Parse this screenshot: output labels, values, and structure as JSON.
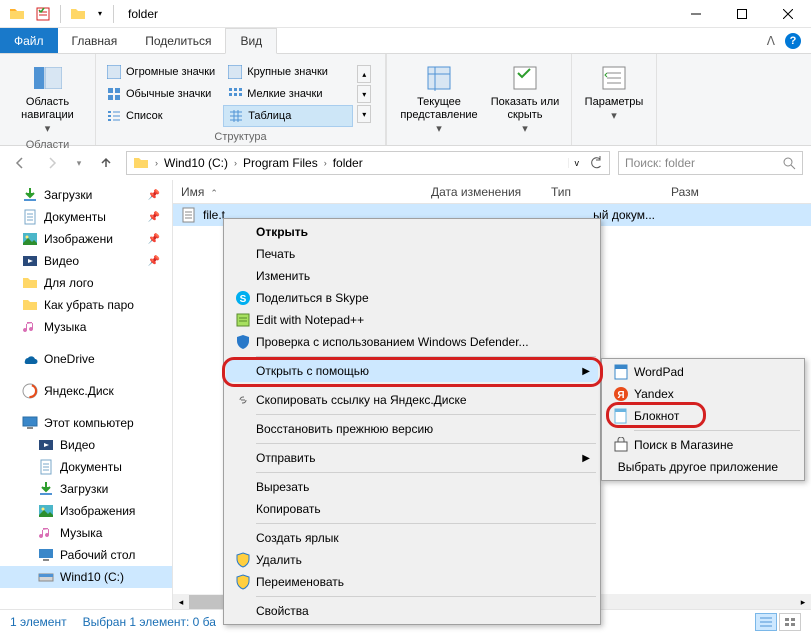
{
  "window": {
    "title": "folder",
    "controls": {
      "min": "—",
      "max": "□",
      "close": "✕"
    }
  },
  "tabs": {
    "file": "Файл",
    "home": "Главная",
    "share": "Поделиться",
    "view": "Вид"
  },
  "ribbon": {
    "nav_pane_label": "Область навигации",
    "layouts": {
      "huge": "Огромные значки",
      "large": "Крупные значки",
      "medium": "Обычные значки",
      "small": "Мелкие значки",
      "list": "Список",
      "table": "Таблица"
    },
    "group_areas": "Области",
    "group_structure": "Структура",
    "current_view": "Текущее представление",
    "show_hide": "Показать или скрыть",
    "options": "Параметры"
  },
  "breadcrumb": {
    "drive": "Wind10 (C:)",
    "folder1": "Program Files",
    "folder2": "folder"
  },
  "search": {
    "placeholder": "Поиск: folder"
  },
  "sidebar": {
    "items": [
      {
        "label": "Загрузки",
        "pinned": true,
        "icon": "download"
      },
      {
        "label": "Документы",
        "pinned": true,
        "icon": "doc"
      },
      {
        "label": "Изображени",
        "pinned": true,
        "icon": "picture"
      },
      {
        "label": "Видео",
        "pinned": true,
        "icon": "video"
      },
      {
        "label": "Для лого",
        "pinned": false,
        "icon": "folder"
      },
      {
        "label": "Как убрать паро",
        "pinned": false,
        "icon": "folder"
      },
      {
        "label": "Музыка",
        "pinned": false,
        "icon": "music"
      }
    ],
    "onedrive": "OneDrive",
    "yandex": "Яндекс.Диск",
    "this_pc": "Этот компьютер",
    "pc_items": [
      {
        "label": "Видео",
        "icon": "video"
      },
      {
        "label": "Документы",
        "icon": "doc"
      },
      {
        "label": "Загрузки",
        "icon": "download"
      },
      {
        "label": "Изображения",
        "icon": "picture"
      },
      {
        "label": "Музыка",
        "icon": "music"
      },
      {
        "label": "Рабочий стол",
        "icon": "desktop"
      },
      {
        "label": "Wind10 (C:)",
        "icon": "drive",
        "selected": true
      }
    ]
  },
  "columns": {
    "name": "Имя",
    "date": "Дата изменения",
    "type": "Тип",
    "size": "Разм"
  },
  "file_row": {
    "name": "file.t",
    "type_suffix": "ый докум..."
  },
  "context_menu": {
    "open": "Открыть",
    "print": "Печать",
    "edit": "Изменить",
    "skype": "Поделиться в Skype",
    "notepadpp": "Edit with Notepad++",
    "defender": "Проверка с использованием Windows Defender...",
    "open_with": "Открыть с помощью",
    "yandex_copy": "Скопировать ссылку на Яндекс.Диске",
    "restore": "Восстановить прежнюю версию",
    "send_to": "Отправить",
    "cut": "Вырезать",
    "copy": "Копировать",
    "shortcut": "Создать ярлык",
    "delete": "Удалить",
    "rename": "Переименовать",
    "properties": "Свойства"
  },
  "submenu": {
    "wordpad": "WordPad",
    "yandex": "Yandex",
    "notepad": "Блокнот",
    "store": "Поиск в Магазине",
    "other": "Выбрать другое приложение"
  },
  "status": {
    "count": "1 элемент",
    "selection": "Выбран 1 элемент: 0 ба"
  }
}
